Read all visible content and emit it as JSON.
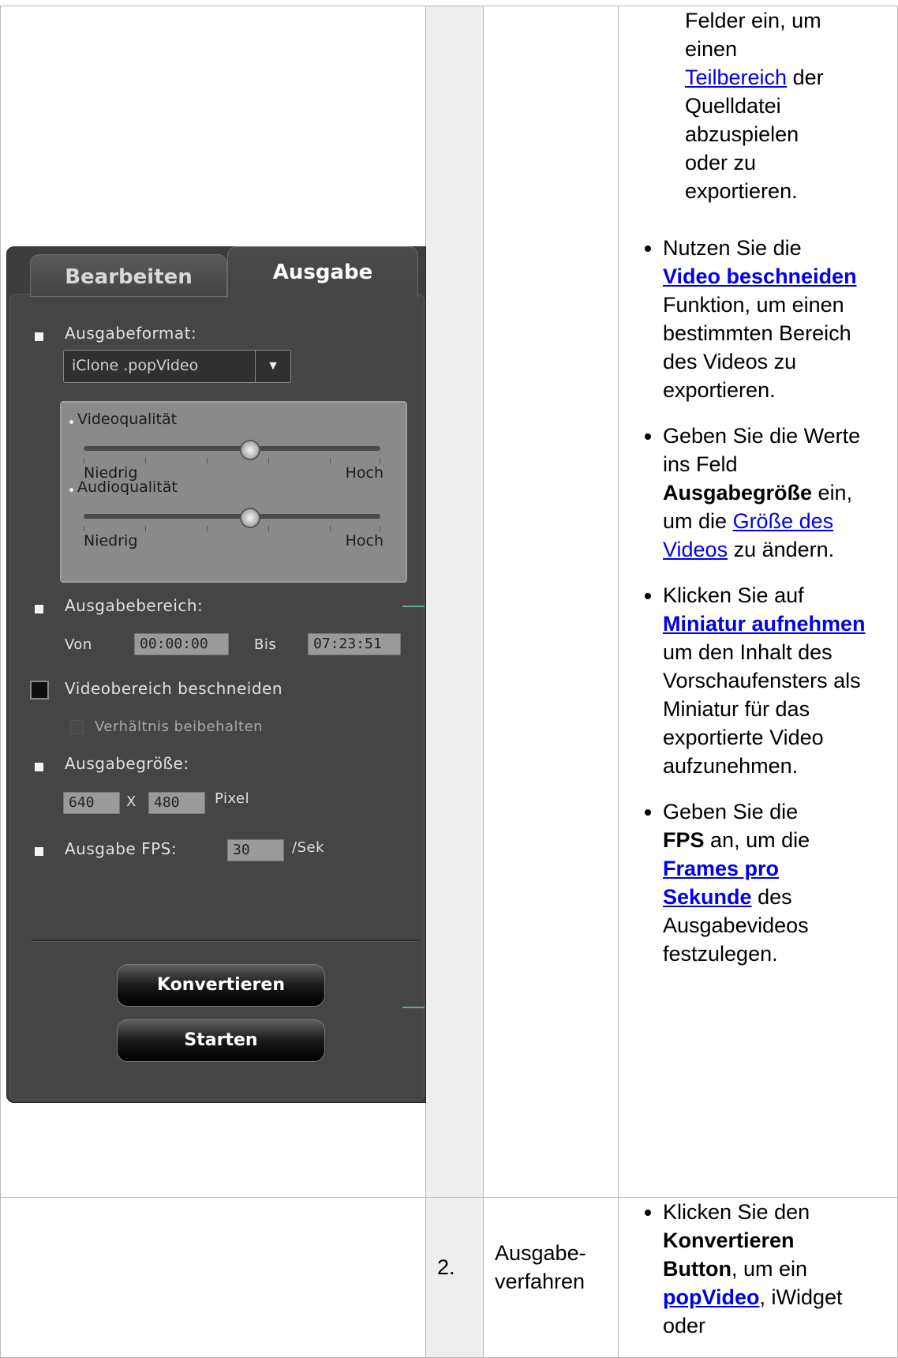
{
  "table": {
    "row1_desc_intro": [
      "Felder ein, um",
      "einen"
    ],
    "row1_desc_intro_link": "Teilbereich",
    "row1_desc_intro_rest": [
      "der",
      "Quelldatei",
      "abzuspielen",
      "oder zu",
      "exportieren."
    ],
    "bullets": [
      {
        "pre": "Nutzen Sie die",
        "link": "Video beschneiden",
        "post": "Funktion, um einen bestimmten Bereich des Videos zu exportieren."
      },
      {
        "pre": "Geben Sie die Werte ins Feld",
        "bold": "Ausgabegröße",
        "mid": "ein, um die",
        "link": "Größe des Videos",
        "post": "zu ändern."
      },
      {
        "pre": "Klicken Sie auf",
        "link": "Miniatur aufnehmen",
        "post": "um den Inhalt des Vorschaufensters als Miniatur für das exportierte Video aufzunehmen."
      },
      {
        "pre": "Geben Sie die",
        "bold": "FPS",
        "mid": "an, um die",
        "link": "Frames pro Sekunde",
        "post": "des Ausgabevideos festzulegen."
      }
    ],
    "row2_num": "2.",
    "row2_step": "Ausgabe-verfahren",
    "row2_bullet": {
      "pre": "Klicken Sie den",
      "bold": "Konvertieren Button",
      "mid": ", um ein",
      "link": "popVideo",
      "post": ", iWidget oder"
    }
  },
  "panel": {
    "tabs": [
      "Bearbeiten",
      "Ausgabe"
    ],
    "output_format_label": "Ausgabeformat:",
    "output_format_value": "iClone .popVideo",
    "video_quality_label": "Videoqualität",
    "audio_quality_label": "Audioqualität",
    "low_label": "Niedrig",
    "high_label": "Hoch",
    "video_quality_level": 0.56,
    "audio_quality_level": 0.56,
    "output_range_label": "Ausgabebereich:",
    "from_label": "Von",
    "from_value": "00:00:00",
    "to_label": "Bis",
    "to_value": "07:23:51",
    "crop_label": "Videobereich beschneiden",
    "keep_ratio_label": "Verhältnis beibehalten",
    "output_size_label": "Ausgabegröße:",
    "width_value": "640",
    "x_label": "X",
    "height_value": "480",
    "pixel_label": "Pixel",
    "fps_label": "Ausgabe FPS:",
    "fps_value": "30",
    "per_sec_label": "/Sek",
    "convert_button": "Konvertieren",
    "start_button": "Starten"
  }
}
